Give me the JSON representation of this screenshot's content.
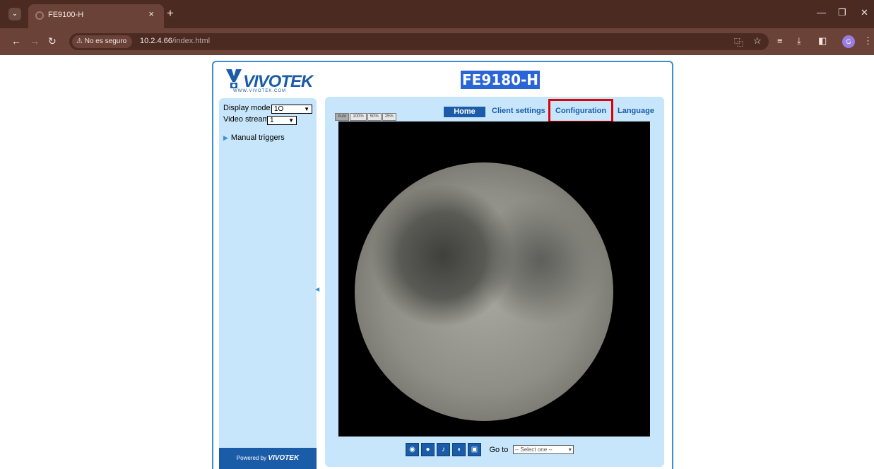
{
  "browser": {
    "tab_title": "FE9100-H",
    "tab_close": "×",
    "new_tab": "+",
    "security_label": "No es seguro",
    "url_host": "10.2.4.66",
    "url_path": "/index.html",
    "icons": [
      "translate-icon",
      "star-icon",
      "media-icon",
      "download-icon",
      "sidepanel-icon",
      "profile-icon",
      "menu-icon"
    ]
  },
  "page": {
    "logo_text": "VIVOTEK",
    "logo_sub": "WWW.VIVOTEK.COM",
    "model": "FE9180-H",
    "sidebar": {
      "display_mode_label": "Display mode",
      "display_mode_value": "1O",
      "video_stream_label": "Video stream",
      "video_stream_value": "1",
      "manual_triggers": "Manual triggers",
      "powered_by": "Powered by",
      "powered_brand": "VIVOTEK"
    },
    "size_buttons": [
      "Auto",
      "100%",
      "50%",
      "25%"
    ],
    "nav": {
      "home": "Home",
      "client_settings": "Client settings",
      "configuration": "Configuration",
      "language": "Language"
    },
    "controls": {
      "goto_label": "Go to",
      "goto_placeholder": "-- Select one --"
    },
    "colors": {
      "accent": "#1a5ca8",
      "panel": "#c8e6fb",
      "highlight_box": "#e00000"
    }
  }
}
